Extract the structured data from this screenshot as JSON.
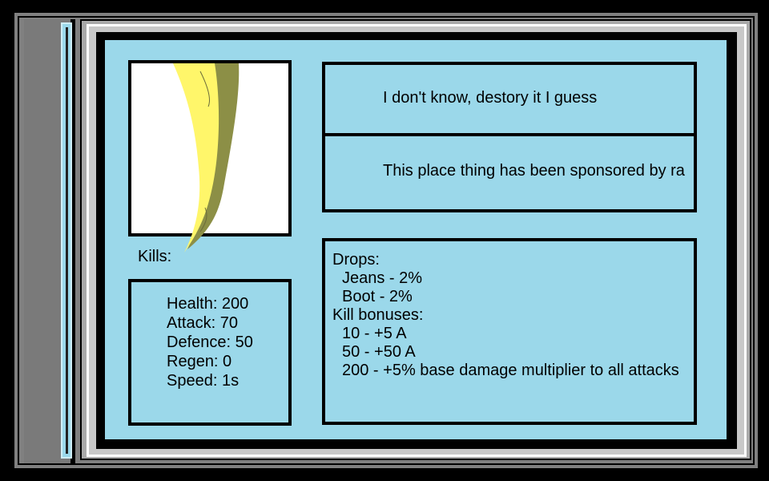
{
  "enemy": {
    "kills_label": "Kills:",
    "stats": [
      "Health: 200",
      "Attack: 70",
      "Defence: 50",
      "Regen: 0",
      "Speed: 1s"
    ],
    "description": "I don't know, destory it I guess",
    "sponsor": "This place thing has been sponsored by ra",
    "drops_header": "Drops:",
    "drops": [
      "Jeans - 2%",
      "Boot - 2%"
    ],
    "bonuses_header": "Kill bonuses:",
    "bonuses": [
      "10 - +5 A",
      "50 - +50 A",
      "200 - +5% base damage multiplier to all attacks"
    ]
  },
  "colors": {
    "panel_bg": "#9bd8ea",
    "frame_gray": "#808080",
    "border": "#000000",
    "banana_yellow": "#fff66a",
    "banana_shadow": "#8c8f46"
  },
  "icons": {
    "portrait": "banana-peel-icon"
  }
}
